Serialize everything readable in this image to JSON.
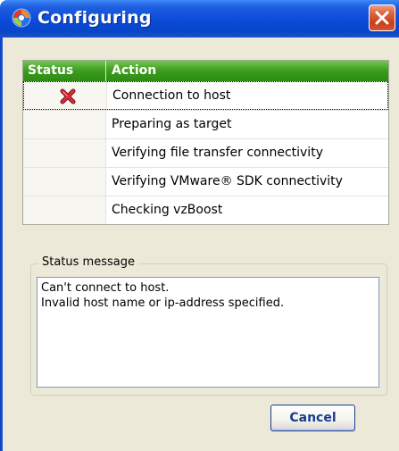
{
  "window": {
    "title": "Configuring",
    "icon": "parallels-logo-icon",
    "close_icon": "close-icon"
  },
  "table": {
    "headers": {
      "status": "Status",
      "action": "Action"
    },
    "rows": [
      {
        "action": "Connection to host",
        "status_icon": "error-x-icon",
        "selected": true
      },
      {
        "action": "Preparing as target",
        "status_icon": "",
        "selected": false
      },
      {
        "action": "Verifying file transfer connectivity",
        "status_icon": "",
        "selected": false
      },
      {
        "action": "Verifying VMware® SDK connectivity",
        "status_icon": "",
        "selected": false
      },
      {
        "action": "Checking vzBoost",
        "status_icon": "",
        "selected": false
      }
    ]
  },
  "status_message": {
    "legend": "Status message",
    "lines": [
      "Can't connect to host.",
      "Invalid host name or ip-address specified."
    ]
  },
  "buttons": {
    "cancel_label": "Cancel"
  },
  "colors": {
    "titlebar": "#0a4ad8",
    "header_green": "#3a9b1c",
    "error_red": "#c0202a",
    "window_bg": "#ece9d8"
  }
}
